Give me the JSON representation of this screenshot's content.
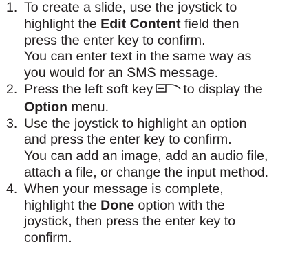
{
  "steps": [
    {
      "number": "1.",
      "lines": [
        {
          "before": "To create a slide, use the joystick to"
        },
        {
          "before": "highlight the ",
          "bold": "Edit Content",
          "after": " field then"
        },
        {
          "before": "press the enter key to confirm."
        },
        {
          "before": "You can enter text in the same way as"
        },
        {
          "before": "you would for an SMS message."
        }
      ]
    },
    {
      "number": "2.",
      "lines": [
        {
          "before": "Press the left soft key",
          "icon": "left-soft-key-icon",
          "after": "to display the"
        },
        {
          "bold": "Option",
          "after": " menu."
        }
      ]
    },
    {
      "number": "3.",
      "lines": [
        {
          "before": "Use the joystick to highlight an option"
        },
        {
          "before": "and press the enter key to confirm."
        },
        {
          "before": "You can add an image, add an audio file,"
        },
        {
          "before": "attach a file, or change the input method."
        }
      ]
    },
    {
      "number": "4.",
      "lines": [
        {
          "before": "When your message is complete,"
        },
        {
          "before": "highlight the ",
          "bold": "Done",
          "after": " option with the"
        },
        {
          "before": "joystick, then press the enter key to"
        },
        {
          "before": "confirm."
        }
      ]
    }
  ]
}
